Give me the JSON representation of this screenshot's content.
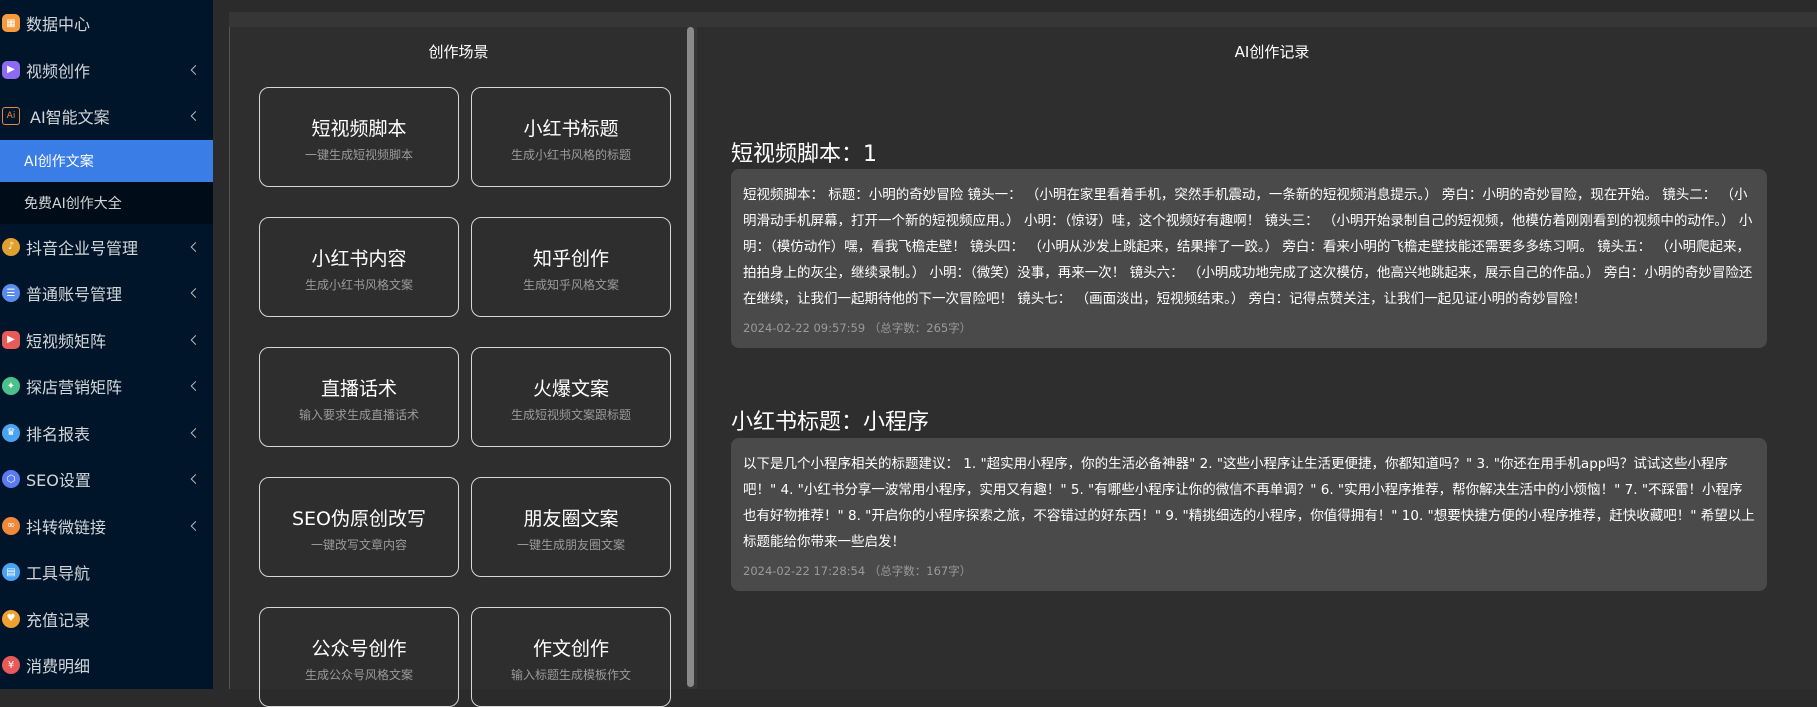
{
  "sidebar": {
    "items": [
      {
        "label": "数据中心",
        "icon": "data-center-icon",
        "color": "#f79a3d",
        "has_arrow": false
      },
      {
        "label": "视频创作",
        "icon": "video-create-icon",
        "color": "#8b6cf0",
        "has_arrow": true
      },
      {
        "label": "AI智能文案",
        "icon": "ai-copy-icon",
        "color": "#e8873a",
        "has_arrow": true
      },
      {
        "label": "抖音企业号管理",
        "icon": "douyin-enterprise-icon",
        "color": "#e0a030",
        "has_arrow": true
      },
      {
        "label": "普通账号管理",
        "icon": "account-manage-icon",
        "color": "#5b8def",
        "has_arrow": true
      },
      {
        "label": "短视频矩阵",
        "icon": "short-video-matrix-icon",
        "color": "#e85a5a",
        "has_arrow": true
      },
      {
        "label": "探店营销矩阵",
        "icon": "store-marketing-icon",
        "color": "#4cc08a",
        "has_arrow": true
      },
      {
        "label": "排名报表",
        "icon": "ranking-report-icon",
        "color": "#4aa3f0",
        "has_arrow": true
      },
      {
        "label": "SEO设置",
        "icon": "seo-settings-icon",
        "color": "#5b7cf0",
        "has_arrow": true
      },
      {
        "label": "抖转微链接",
        "icon": "link-icon",
        "color": "#f08a3a",
        "has_arrow": true
      },
      {
        "label": "工具导航",
        "icon": "tool-nav-icon",
        "color": "#4aa3f0",
        "has_arrow": false
      },
      {
        "label": "充值记录",
        "icon": "recharge-icon",
        "color": "#f0a030",
        "has_arrow": false
      },
      {
        "label": "消费明细",
        "icon": "consume-detail-icon",
        "color": "#e85a5a",
        "has_arrow": false
      }
    ],
    "sub_items": [
      {
        "label": "AI创作文案",
        "active": true
      },
      {
        "label": "免费AI创作大全",
        "active": false
      }
    ]
  },
  "scenes": {
    "title": "创作场景",
    "cards": [
      {
        "title": "短视频脚本",
        "subtitle": "一键生成短视频脚本"
      },
      {
        "title": "小红书标题",
        "subtitle": "生成小红书风格的标题"
      },
      {
        "title": "小红书内容",
        "subtitle": "生成小红书风格文案"
      },
      {
        "title": "知乎创作",
        "subtitle": "生成知乎风格文案"
      },
      {
        "title": "直播话术",
        "subtitle": "输入要求生成直播话术"
      },
      {
        "title": "火爆文案",
        "subtitle": "生成短视频文案跟标题"
      },
      {
        "title": "SEO伪原创改写",
        "subtitle": "一键改写文章内容"
      },
      {
        "title": "朋友圈文案",
        "subtitle": "一键生成朋友圈文案"
      },
      {
        "title": "公众号创作",
        "subtitle": "生成公众号风格文案"
      },
      {
        "title": "作文创作",
        "subtitle": "输入标题生成模板作文"
      }
    ]
  },
  "records": {
    "title": "AI创作记录",
    "items": [
      {
        "heading": "短视频脚本：1",
        "text": "短视频脚本： 标题：小明的奇妙冒险 镜头一： （小明在家里看着手机，突然手机震动，一条新的短视频消息提示。） 旁白：小明的奇妙冒险，现在开始。 镜头二： （小明滑动手机屏幕，打开一个新的短视频应用。） 小明：（惊讶）哇，这个视频好有趣啊！ 镜头三： （小明开始录制自己的短视频，他模仿着刚刚看到的视频中的动作。） 小明：（模仿动作）嘿，看我飞檐走壁！ 镜头四： （小明从沙发上跳起来，结果摔了一跤。） 旁白：看来小明的飞檐走壁技能还需要多多练习啊。 镜头五： （小明爬起来，拍拍身上的灰尘，继续录制。） 小明：（微笑）没事，再来一次！ 镜头六： （小明成功地完成了这次模仿，他高兴地跳起来，展示自己的作品。） 旁白：小明的奇妙冒险还在继续，让我们一起期待他的下一次冒险吧！ 镜头七： （画面淡出，短视频结束。） 旁白：记得点赞关注，让我们一起见证小明的奇妙冒险！",
        "meta": "2024-02-22 09:57:59 （总字数：265字）"
      },
      {
        "heading": "小红书标题：小程序",
        "text": "以下是几个小程序相关的标题建议： 1. \"超实用小程序，你的生活必备神器\" 2. \"这些小程序让生活更便捷，你都知道吗？\" 3. \"你还在用手机app吗？试试这些小程序吧！\" 4. \"小红书分享一波常用小程序，实用又有趣！\" 5. \"有哪些小程序让你的微信不再单调？\" 6. \"实用小程序推荐，帮你解决生活中的小烦恼！\" 7. \"不踩雷！小程序也有好物推荐！\" 8. \"开启你的小程序探索之旅，不容错过的好东西！\" 9. \"精挑细选的小程序，你值得拥有！\" 10. \"想要快捷方便的小程序推荐，赶快收藏吧！\" 希望以上标题能给你带来一些启发！",
        "meta": "2024-02-22 17:28:54 （总字数：167字）"
      }
    ]
  }
}
